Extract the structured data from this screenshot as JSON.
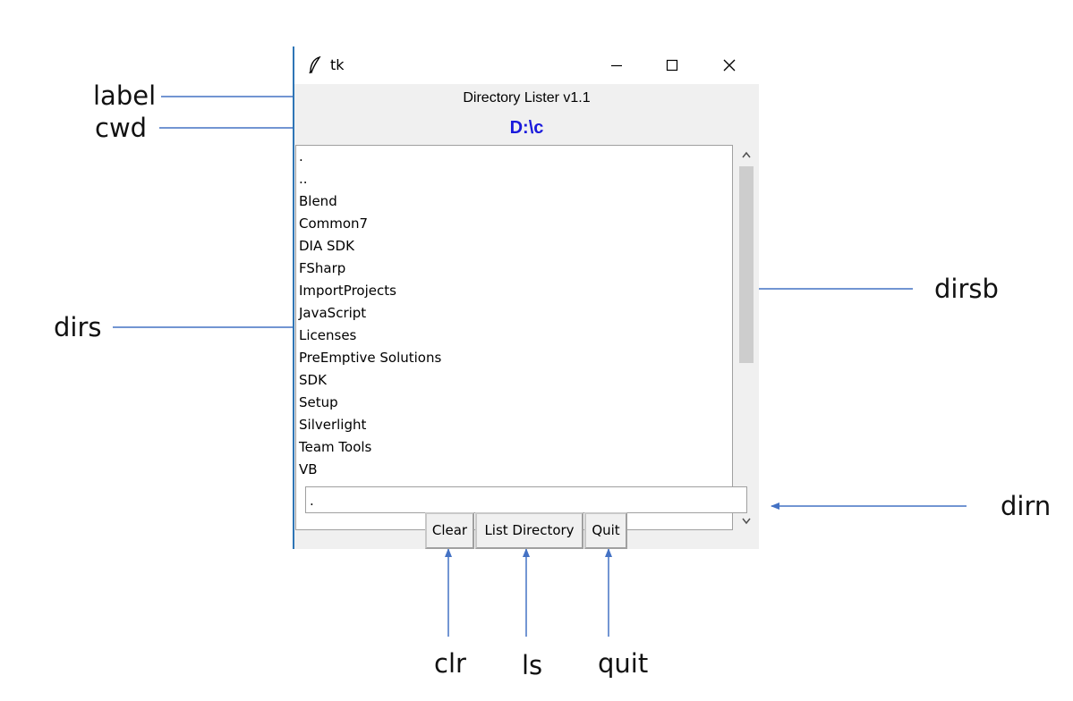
{
  "window": {
    "title": "tk",
    "label": "Directory Lister v1.1",
    "cwd": "D:\\c",
    "cwd_color": "#1a1adc",
    "accent_color": "#2e75b6",
    "icons": [
      "feather-icon",
      "minimize-icon",
      "maximize-icon",
      "close-icon"
    ]
  },
  "listbox": {
    "items": [
      ".",
      "..",
      "Blend",
      "Common7",
      "DIA SDK",
      "FSharp",
      "ImportProjects",
      "JavaScript",
      "Licenses",
      "PreEmptive Solutions",
      "SDK",
      "Setup",
      "Silverlight",
      "Team Tools",
      "VB"
    ]
  },
  "entry": {
    "value": "."
  },
  "buttons": {
    "clear": "Clear",
    "list": "List Directory",
    "quit": "Quit"
  },
  "annotations": {
    "label": "label",
    "cwd": "cwd",
    "dirs": "dirs",
    "dirsb": "dirsb",
    "dirn": "dirn",
    "clr": "clr",
    "ls": "ls",
    "quit": "quit"
  }
}
